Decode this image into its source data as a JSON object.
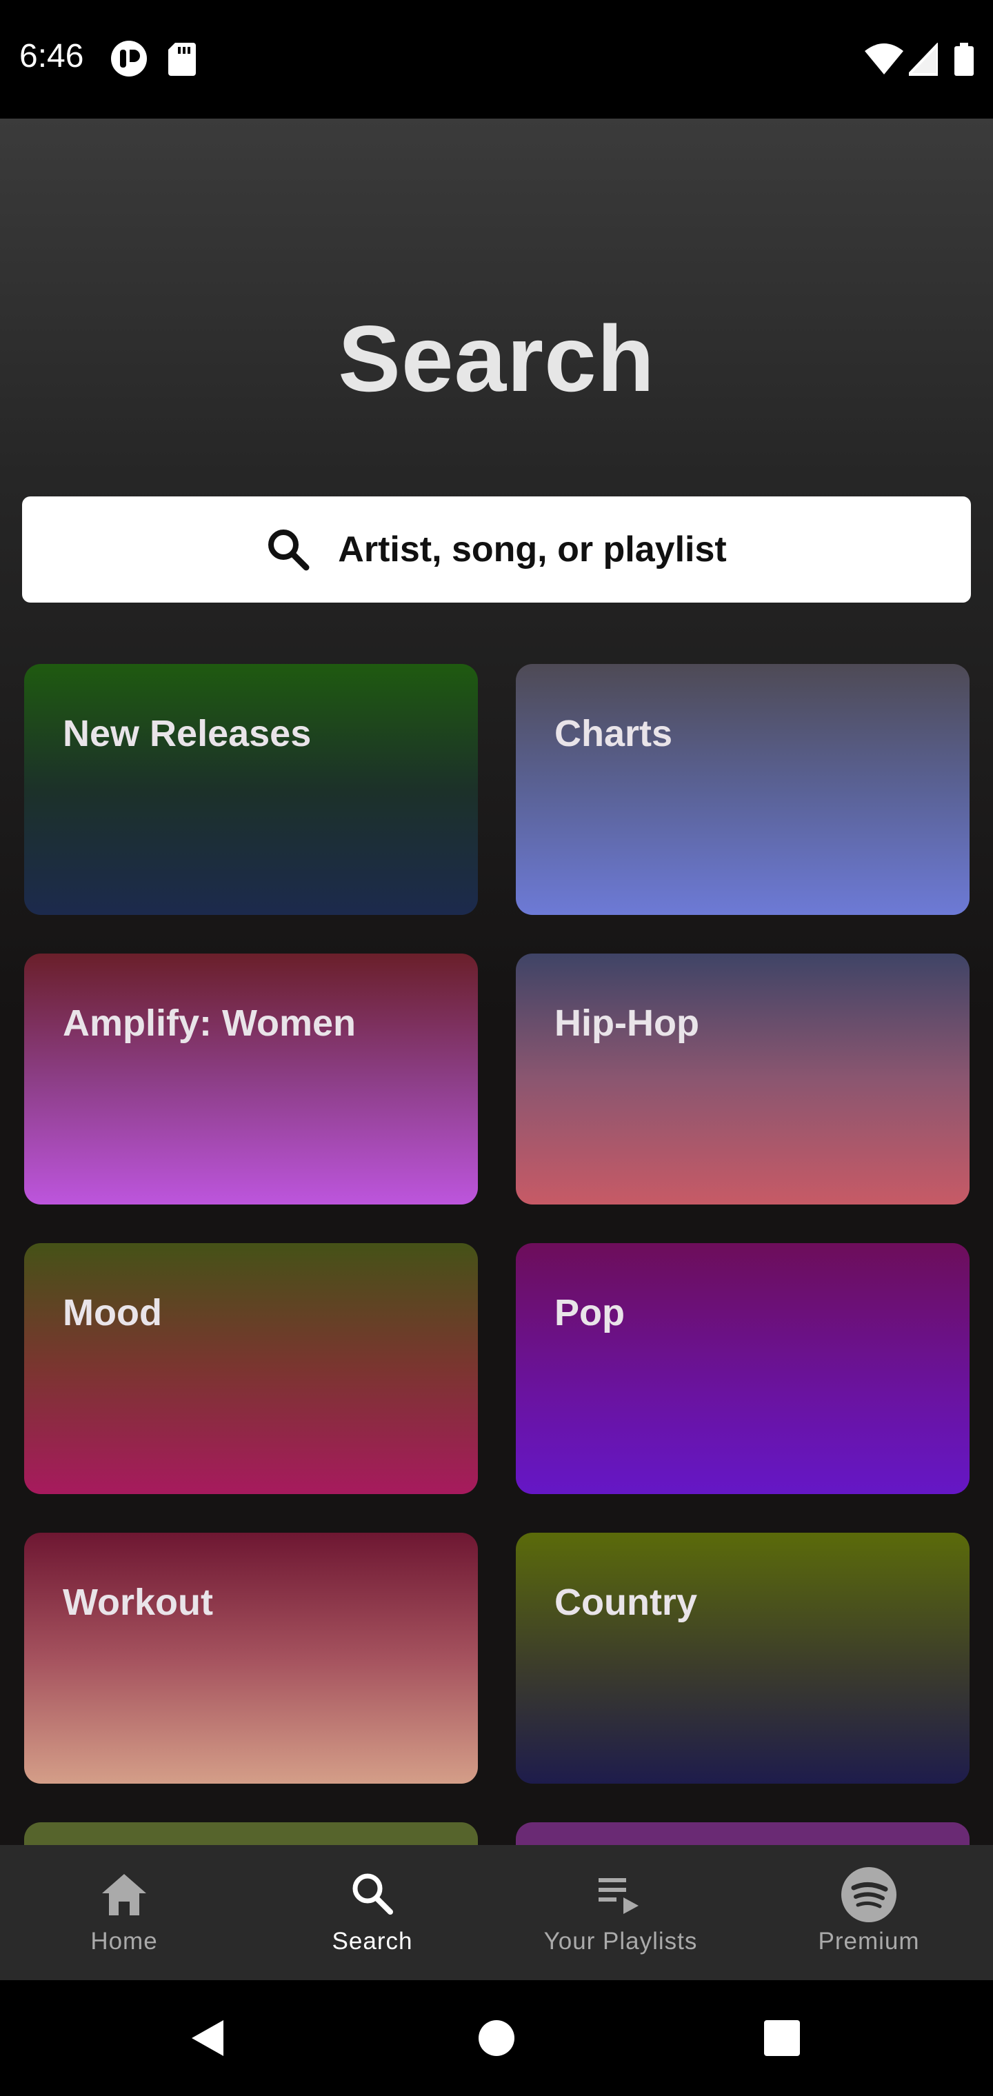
{
  "status_bar": {
    "time": "6:46",
    "icons": [
      "app-notification-icon",
      "sd-card-icon",
      "wifi-icon",
      "signal-icon",
      "battery-icon"
    ]
  },
  "header": {
    "title": "Search"
  },
  "search": {
    "placeholder": "Artist, song, or playlist",
    "icon": "search-icon"
  },
  "categories": [
    {
      "label": "New Releases"
    },
    {
      "label": "Charts"
    },
    {
      "label": "Amplify: Women"
    },
    {
      "label": "Hip-Hop"
    },
    {
      "label": "Mood"
    },
    {
      "label": "Pop"
    },
    {
      "label": "Workout"
    },
    {
      "label": "Country"
    }
  ],
  "bottom_nav": {
    "items": [
      {
        "label": "Home",
        "icon": "home-icon",
        "active": false
      },
      {
        "label": "Search",
        "icon": "search-icon",
        "active": true
      },
      {
        "label": "Your Playlists",
        "icon": "playlist-icon",
        "active": false
      },
      {
        "label": "Premium",
        "icon": "spotify-logo-icon",
        "active": false
      }
    ]
  },
  "system_nav": {
    "buttons": [
      "back-icon",
      "home-circle-icon",
      "recents-icon"
    ]
  },
  "colors": {
    "background": "#121212",
    "nav_background": "#2a2a2a",
    "active_label": "#ffffff",
    "inactive_label": "#aaaaaa"
  }
}
